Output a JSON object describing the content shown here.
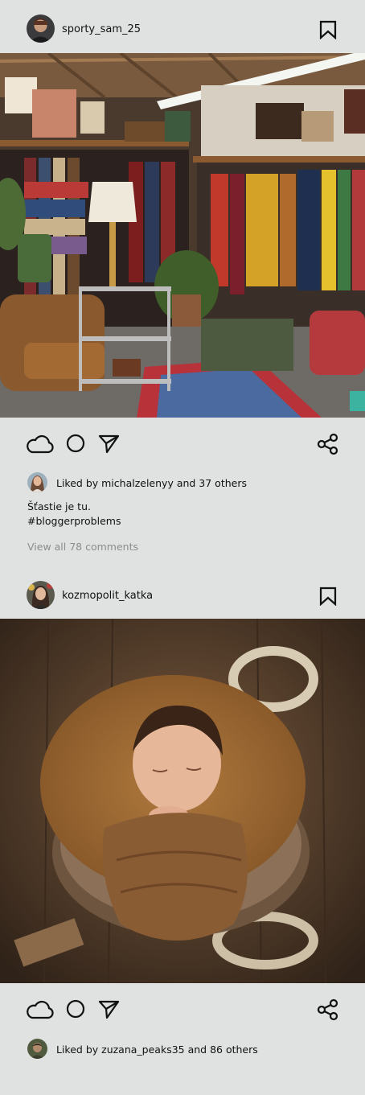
{
  "posts": [
    {
      "username": "sporty_sam_25",
      "liked_by": "Liked by michalzelenyy and 37 others",
      "caption_line1": "Šťastie je tu.",
      "caption_line2": "#bloggerproblems",
      "view_comments": "View all 78 comments",
      "photo_description_icon": "vintage-shop-photo"
    },
    {
      "username": "kozmopolit_katka",
      "liked_by": "Liked by zuzana_peaks35 and 86 others",
      "photo_description_icon": "newborn-photo"
    }
  ],
  "icons": {
    "bookmark": "bookmark-icon",
    "like": "cloud-icon",
    "comment": "comment-icon",
    "send": "send-icon",
    "share": "share-icon"
  },
  "colors": {
    "background": "#dfe2e1",
    "text": "#111111",
    "muted": "#8a8d8c"
  }
}
